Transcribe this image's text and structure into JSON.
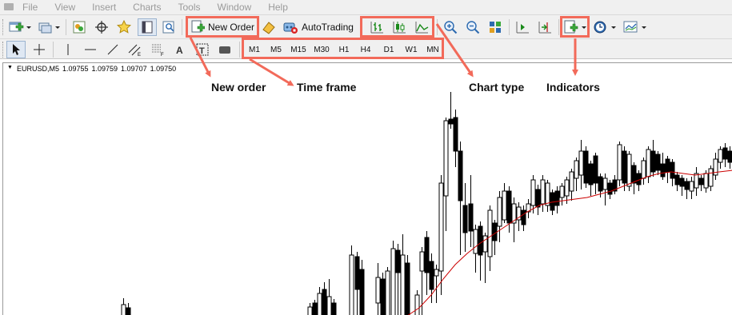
{
  "menu": [
    "File",
    "View",
    "Insert",
    "Charts",
    "Tools",
    "Window",
    "Help"
  ],
  "toolbar": {
    "new_order_label": "New Order",
    "autotrading_label": "AutoTrading"
  },
  "timeframes": [
    "M1",
    "M5",
    "M15",
    "M30",
    "H1",
    "H4",
    "D1",
    "W1",
    "MN"
  ],
  "chart": {
    "symbol": "EURUSD,M5",
    "open": "1.09755",
    "high": "1.09759",
    "low": "1.09707",
    "close": "1.09750",
    "ma_color": "#cc0000",
    "candle_up_color": "#ffffff",
    "candle_down_color": "#000000"
  },
  "annotations": {
    "new_order": "New order",
    "time_frame": "Time frame",
    "chart_type": "Chart type",
    "indicators": "Indicators"
  },
  "highlight_color": "#f26a5a",
  "icons": [
    "new-chart-icon",
    "profiles-icon",
    "market-watch-icon",
    "data-window-icon",
    "navigator-icon",
    "terminal-icon",
    "strategy-tester-icon",
    "new-order-icon",
    "metaeditor-icon",
    "autotrading-icon",
    "bar-chart-icon",
    "candlesticks-icon",
    "line-chart-icon",
    "zoom-in-icon",
    "zoom-out-icon",
    "tile-windows-icon",
    "chart-shift-icon",
    "auto-scroll-icon",
    "indicators-icon",
    "periods-icon",
    "templates-icon",
    "cursor-icon",
    "crosshair-icon",
    "vertical-line-icon",
    "horizontal-line-icon",
    "trendline-icon",
    "equidistant-channel-icon",
    "fibonacci-icon",
    "text-icon",
    "text-label-icon",
    "arrows-icon"
  ]
}
